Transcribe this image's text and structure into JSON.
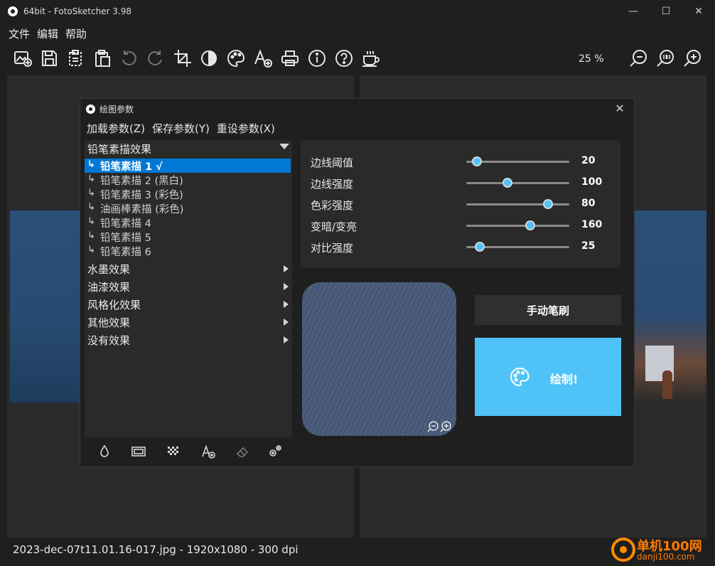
{
  "window": {
    "title": "64bit - FotoSketcher 3.98",
    "min": "—",
    "max": "☐",
    "close": "✕"
  },
  "menu": [
    "文件",
    "编辑",
    "帮助"
  ],
  "toolbar": {
    "zoom_level": "25 %",
    "icons": [
      "open-image-icon",
      "save-icon",
      "copy-icon",
      "paste-icon",
      "undo-icon",
      "redo-icon",
      "crop-icon",
      "contrast-icon",
      "palette-icon",
      "add-text-icon",
      "print-icon",
      "info-icon",
      "help-icon",
      "coffee-icon",
      "zoom-out-icon",
      "zoom-1to1-icon",
      "zoom-in-icon"
    ]
  },
  "status": {
    "text": "2023-dec-07t11.01.16-017.jpg - 1920x1080 - 300 dpi"
  },
  "watermark": {
    "title": "单机100网",
    "url": "danji100.com"
  },
  "dialog": {
    "title": "绘图参数",
    "close": "✕",
    "menu": [
      "加载参数(Z)",
      "保存参数(Y)",
      "重设参数(X)"
    ],
    "effects": {
      "group": "铅笔素描效果",
      "hook": "↳",
      "items": [
        "铅笔素描 1 √",
        "铅笔素描 2 (黑白)",
        "铅笔素描 3 (彩色)",
        "油画棒素描 (彩色)",
        "铅笔素描 4",
        "铅笔素描 5",
        "铅笔素描 6"
      ],
      "selected_index": 0,
      "categories": [
        "水墨效果",
        "油漆效果",
        "风格化效果",
        "其他效果",
        "没有效果"
      ]
    },
    "params": [
      {
        "label": "边线阈值",
        "value": "20",
        "level": 0.1
      },
      {
        "label": "边线强度",
        "value": "100",
        "level": 0.4
      },
      {
        "label": "色彩强度",
        "value": "80",
        "level": 0.79
      },
      {
        "label": "变暗/变亮",
        "value": "160",
        "level": 0.62
      },
      {
        "label": "对比强度",
        "value": "25",
        "level": 0.13
      }
    ],
    "brush_button": "手动笔刷",
    "draw_button": "绘制!",
    "accent": "#4fc3f7",
    "selection": "#0078d4"
  }
}
